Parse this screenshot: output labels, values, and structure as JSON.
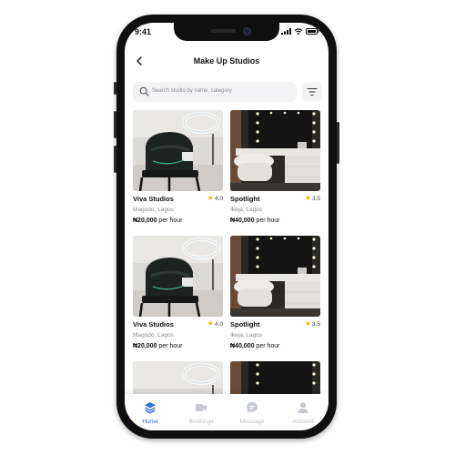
{
  "status_bar": {
    "time": "9:41"
  },
  "header": {
    "title": "Make Up Studios"
  },
  "search": {
    "placeholder": "Search studio by name, category"
  },
  "studios": [
    {
      "name": "Viva Studios",
      "rating": "4.0",
      "location": "Magodo, Lagos",
      "price": "₦20,000",
      "unit": "per hour",
      "image": "ring-light-chair"
    },
    {
      "name": "Spotlight",
      "rating": "3.5",
      "location": "Ikeja, Lagos",
      "price": "₦40,000",
      "unit": "per hour",
      "image": "vanity-mirror"
    },
    {
      "name": "Viva Studios",
      "rating": "4.0",
      "location": "Magodo, Lagos",
      "price": "₦20,000",
      "unit": "per hour",
      "image": "ring-light-chair"
    },
    {
      "name": "Spotlight",
      "rating": "3.5",
      "location": "Ikeja, Lagos",
      "price": "₦40,000",
      "unit": "per hour",
      "image": "vanity-mirror"
    }
  ],
  "tabbar": {
    "items": [
      {
        "label": "Home",
        "icon": "layers-icon",
        "active": true
      },
      {
        "label": "Bookings",
        "icon": "bookings-icon",
        "active": false
      },
      {
        "label": "Message",
        "icon": "message-icon",
        "active": false
      },
      {
        "label": "Account",
        "icon": "user-icon",
        "active": false
      }
    ]
  },
  "colors": {
    "accent": "#2f6fe4",
    "star": "#f2b705",
    "inactive": "#b8bcc4"
  }
}
